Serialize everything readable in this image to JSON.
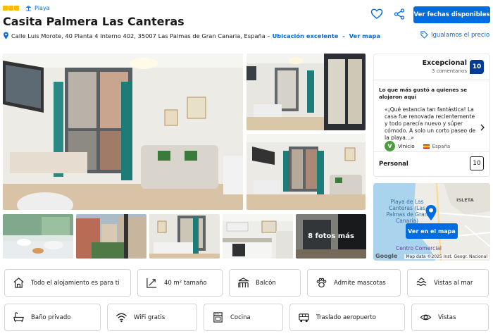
{
  "header": {
    "stars": 3,
    "badge_label": "Playa",
    "title": "Casita Palmera Las Canteras",
    "address": "Calle Luis Morote, 40 Planta 4 Interno 402, 35007 Las Palmas de Gran Canaria, España –",
    "location_rating": "Ubicación excelente",
    "location_sep": " - ",
    "map_link": "Ver mapa",
    "cta_label": "Ver fechas disponibles",
    "price_match": "Igualamos el precio"
  },
  "gallery": {
    "more_photos": "8 fotos más"
  },
  "review": {
    "rating_word": "Excepcional",
    "review_count": "3 comentarios",
    "score": "10",
    "question": "Lo que más gustó a quienes se alojaron aquí",
    "quote": "«¡Qué estancia tan fantástica! La casa fue renovada recientemente y todo parecía nuevo y súper cómodo. A solo un corto paseo de la playa...»",
    "reviewer_initial": "V",
    "reviewer_name": "Vinicio",
    "reviewer_country": "España",
    "category": "Personal",
    "category_score": "10"
  },
  "map": {
    "button": "Ver en el mapa",
    "label_beach": "Playa de Las Canteras (Las Palmas de Gran Canaria)",
    "label_isleta": "ISLETA",
    "label_mall": "Centro Comercial",
    "google": "Google",
    "credit": "Map data ©2025 Inst. Geogr. Nacional"
  },
  "facilities": [
    {
      "label": "Todo el alojamiento es para ti",
      "icon": "house-icon"
    },
    {
      "label": "40 m² tamaño",
      "icon": "size-icon"
    },
    {
      "label": "Balcón",
      "icon": "balcony-icon"
    },
    {
      "label": "Admite mascotas",
      "icon": "paw-icon"
    },
    {
      "label": "Vistas al mar",
      "icon": "sea-view-icon"
    },
    {
      "label": "Baño privado",
      "icon": "bath-icon"
    },
    {
      "label": "WiFi gratis",
      "icon": "wifi-icon"
    },
    {
      "label": "Cocina",
      "icon": "kitchen-icon"
    },
    {
      "label": "Traslado aeropuerto",
      "icon": "shuttle-icon"
    },
    {
      "label": "Vistas",
      "icon": "eye-icon"
    }
  ],
  "colors": {
    "primary": "#006ce4",
    "score_bg": "#003b95",
    "star": "#febb02"
  }
}
